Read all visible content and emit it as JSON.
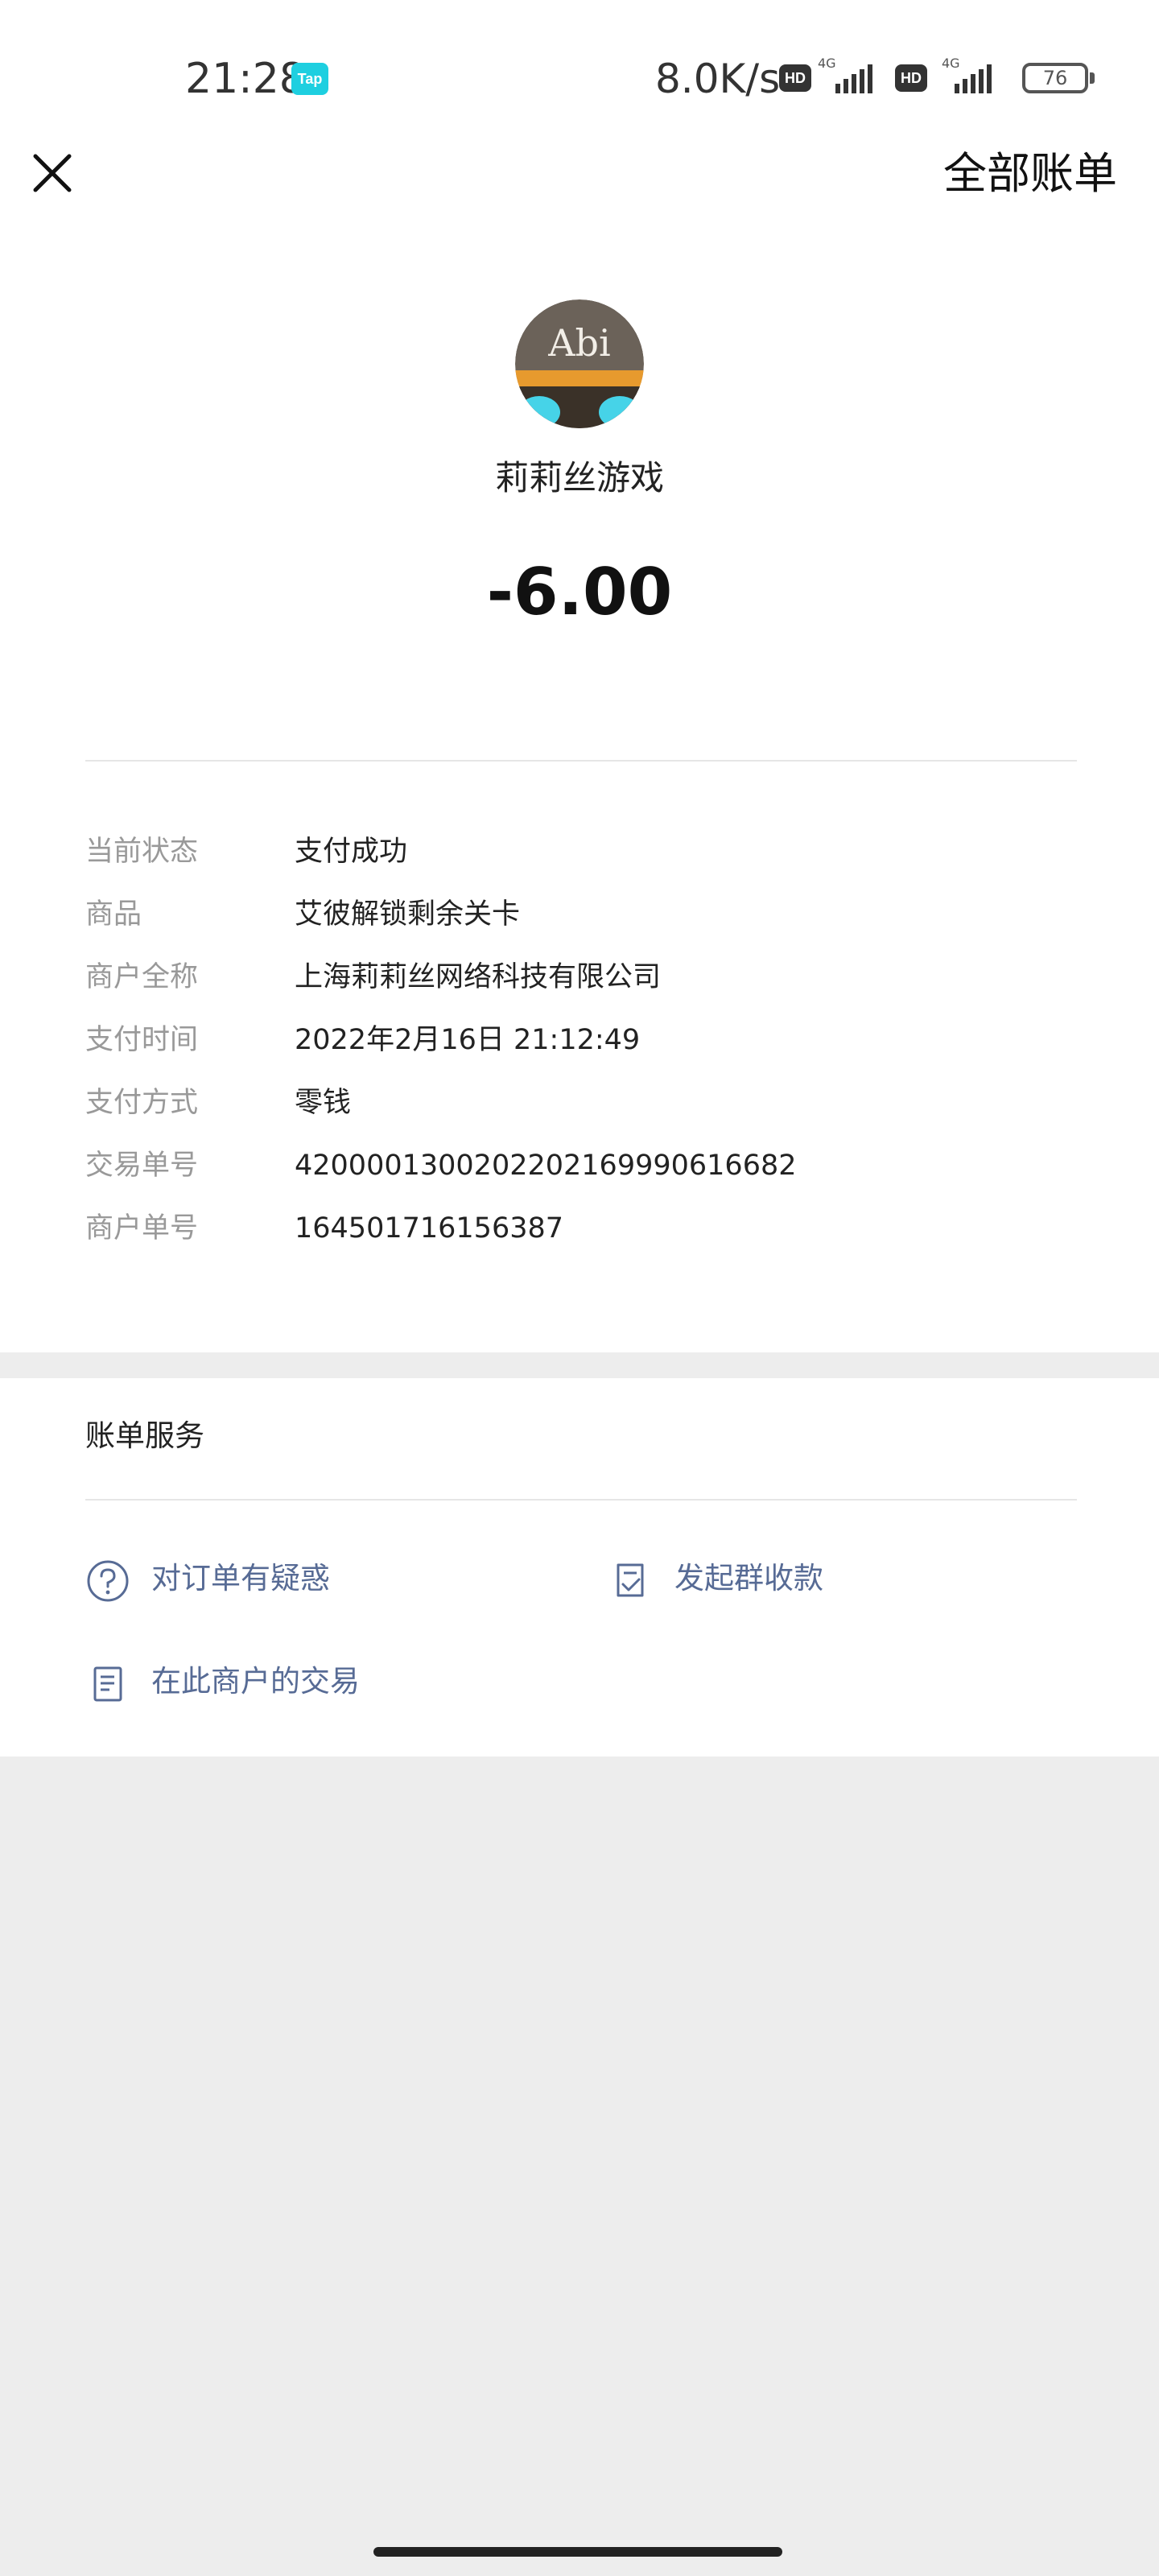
{
  "status_bar": {
    "time": "21:28",
    "tap_badge": "Tap",
    "net_speed": "8.0K/s",
    "hd_label": "HD",
    "network_type": "4G",
    "battery": "76"
  },
  "header": {
    "close_icon": "close-icon",
    "all_bills_label": "全部账单"
  },
  "merchant": {
    "avatar_text": "Abi",
    "name": "莉莉丝游戏",
    "amount": "-6.00"
  },
  "details": [
    {
      "label": "当前状态",
      "value": "支付成功"
    },
    {
      "label": "商品",
      "value": "艾彼解锁剩余关卡"
    },
    {
      "label": "商户全称",
      "value": "上海莉莉丝网络科技有限公司"
    },
    {
      "label": "支付时间",
      "value": "2022年2月16日 21:12:49"
    },
    {
      "label": "支付方式",
      "value": "零钱"
    },
    {
      "label": "交易单号",
      "value": "4200001300202202169990616682"
    },
    {
      "label": "商户单号",
      "value": "164501716156387"
    }
  ],
  "service": {
    "title": "账单服务",
    "items": [
      {
        "label": "对订单有疑惑",
        "icon": "question-circle-icon"
      },
      {
        "label": "发起群收款",
        "icon": "receipt-check-icon"
      },
      {
        "label": "在此商户的交易",
        "icon": "document-list-icon"
      }
    ]
  },
  "colors": {
    "link": "#576b95",
    "page_bg": "#ededed",
    "card_bg": "#ffffff",
    "label_gray": "#999999"
  }
}
